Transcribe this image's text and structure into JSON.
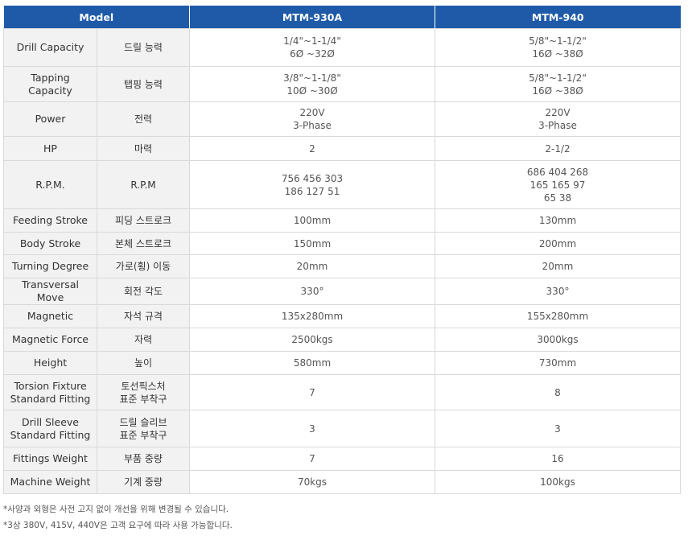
{
  "header": {
    "model": "Model",
    "col1": "MTM-930A",
    "col2": "MTM-940"
  },
  "rows": [
    {
      "en": [
        "Drill Capacity"
      ],
      "ko": [
        "드릴 능력"
      ],
      "v1": [
        "1/4\"~1-1/4\"",
        "6Ø ~32Ø"
      ],
      "v2": [
        "5/8\"~1-1/2\"",
        "16Ø ~38Ø"
      ]
    },
    {
      "en": [
        "Tapping",
        "Capacity"
      ],
      "ko": [
        "탭핑 능력"
      ],
      "v1": [
        "3/8\"~1-1/8\"",
        "10Ø ~30Ø"
      ],
      "v2": [
        "5/8\"~1-1/2\"",
        "16Ø ~38Ø"
      ]
    },
    {
      "en": [
        "Power"
      ],
      "ko": [
        "전력"
      ],
      "v1": [
        "220V",
        "3-Phase"
      ],
      "v2": [
        "220V",
        "3-Phase"
      ]
    },
    {
      "en": [
        "HP"
      ],
      "ko": [
        "마력"
      ],
      "v1": [
        "2"
      ],
      "v2": [
        "2-1/2"
      ]
    },
    {
      "en": [
        "R.P.M."
      ],
      "ko": [
        "R.P.M"
      ],
      "v1": [
        "756 456 303",
        "186 127 51"
      ],
      "v2": [
        "686 404 268",
        "165 165 97",
        "65 38"
      ]
    },
    {
      "en": [
        "Feeding Stroke"
      ],
      "ko": [
        "피딩 스트로크"
      ],
      "v1": [
        "100mm"
      ],
      "v2": [
        "130mm"
      ]
    },
    {
      "en": [
        "Body Stroke"
      ],
      "ko": [
        "본체 스트로크"
      ],
      "v1": [
        "150mm"
      ],
      "v2": [
        "200mm"
      ]
    },
    {
      "en": [
        "Turning Degree"
      ],
      "ko": [
        "가로(횡) 이동"
      ],
      "v1": [
        "20mm"
      ],
      "v2": [
        "20mm"
      ]
    },
    {
      "en": [
        "Transversal Move"
      ],
      "ko": [
        "회전 각도"
      ],
      "v1": [
        "330°"
      ],
      "v2": [
        "330°"
      ]
    },
    {
      "en": [
        "Magnetic"
      ],
      "ko": [
        "자석 규격"
      ],
      "v1": [
        "135x280mm"
      ],
      "v2": [
        "155x280mm"
      ]
    },
    {
      "en": [
        "Magnetic Force"
      ],
      "ko": [
        "자력"
      ],
      "v1": [
        "2500kgs"
      ],
      "v2": [
        "3000kgs"
      ]
    },
    {
      "en": [
        "Height"
      ],
      "ko": [
        "높이"
      ],
      "v1": [
        "580mm"
      ],
      "v2": [
        "730mm"
      ]
    },
    {
      "en": [
        "Torsion Fixture",
        "Standard Fitting"
      ],
      "ko": [
        "토선픽스처",
        "표준 부착구"
      ],
      "v1": [
        "7"
      ],
      "v2": [
        "8"
      ]
    },
    {
      "en": [
        "Drill Sleeve",
        "Standard Fitting"
      ],
      "ko": [
        "드릴 슬리브",
        "표준 부착구"
      ],
      "v1": [
        "3"
      ],
      "v2": [
        "3"
      ]
    },
    {
      "en": [
        "Fittings Weight"
      ],
      "ko": [
        "부품 중량"
      ],
      "v1": [
        "7"
      ],
      "v2": [
        "16"
      ]
    },
    {
      "en": [
        "Machine Weight"
      ],
      "ko": [
        "기계 중량"
      ],
      "v1": [
        "70kgs"
      ],
      "v2": [
        "100kgs"
      ]
    }
  ],
  "notes": [
    "*사양과 외형은 사전 고지 없이 개선을 위해 변경될 수 있습니다.",
    "*3상 380V, 415V, 440V은 고객 요구에 따라 사용 가능합니다."
  ]
}
